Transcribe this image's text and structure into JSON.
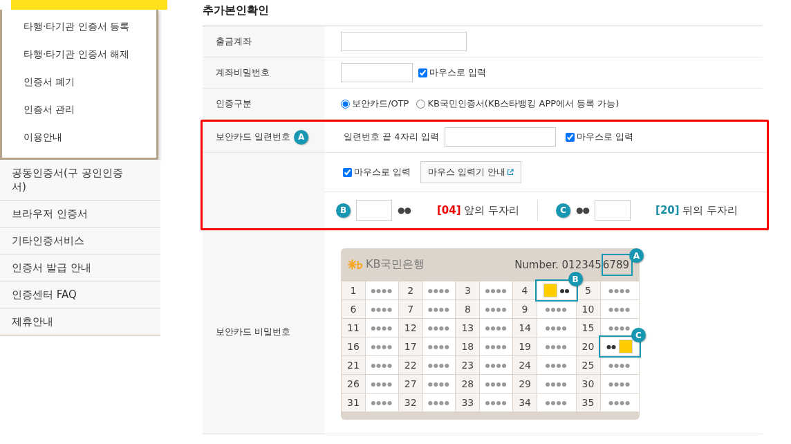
{
  "sidebar": {
    "submenu": [
      "타행·타기관 인증서 등록",
      "타행·타기관 인증서 해제",
      "인증서 폐기",
      "인증서 관리",
      "이용안내"
    ],
    "menu": [
      "공동인증서(구 공인인증서)",
      "브라우저 인증서",
      "기타인증서비스",
      "인증서 발급 안내",
      "인증센터 FAQ",
      "제휴안내"
    ]
  },
  "title": "추가본인확인",
  "rows": [
    {
      "kind": "text",
      "label": "출금계좌"
    },
    {
      "kind": "password",
      "label": "계좌비밀번호",
      "mouse_label": "마우스로 입력",
      "mouse_checked": true
    },
    {
      "kind": "radio",
      "label": "인증구분",
      "options": [
        {
          "label": "보안카드/OTP",
          "selected": true
        },
        {
          "label": "KB국민인증서(KB스타뱅킹 APP에서 등록 가능)",
          "selected": false
        }
      ]
    }
  ],
  "security": {
    "label": "보안카드 일련번호",
    "marker": "A",
    "serial_prompt": "일련번호 끝 4자리 입력",
    "serial_mouse_label": "마우스로 입력",
    "serial_mouse_checked": true,
    "mouse_label": "마우스로 입력",
    "mouse_checked": true,
    "guide_button": "마우스 입력기 안내",
    "front": {
      "marker": "B",
      "dots": "●●",
      "index": "[04]",
      "caption": "앞의 두자리"
    },
    "back": {
      "marker": "C",
      "dots": "●●",
      "index": "[20]",
      "caption": "뒤의 두자리"
    }
  },
  "card_row": {
    "label": "보안카드 비밀번호",
    "bank": "KB국민은행",
    "number": "Number. 012345",
    "number_tail": "6789",
    "number_marker": "A",
    "cells": [
      {
        "no": "1",
        "kind": "hidden",
        "dots": "●●●●"
      },
      {
        "no": "2",
        "kind": "hidden",
        "dots": "●●●●"
      },
      {
        "no": "3",
        "kind": "hidden",
        "dots": "●●●●"
      },
      {
        "no": "4",
        "kind": "front",
        "dots": "●●",
        "marker": "B"
      },
      {
        "no": "5",
        "kind": "hidden",
        "dots": "●●●●"
      },
      {
        "no": "6",
        "kind": "hidden",
        "dots": "●●●●"
      },
      {
        "no": "7",
        "kind": "hidden",
        "dots": "●●●●"
      },
      {
        "no": "8",
        "kind": "hidden",
        "dots": "●●●●"
      },
      {
        "no": "9",
        "kind": "hidden",
        "dots": "●●●●"
      },
      {
        "no": "10",
        "kind": "hidden",
        "dots": "●●●●"
      },
      {
        "no": "11",
        "kind": "hidden",
        "dots": "●●●●"
      },
      {
        "no": "12",
        "kind": "hidden",
        "dots": "●●●●"
      },
      {
        "no": "13",
        "kind": "hidden",
        "dots": "●●●●"
      },
      {
        "no": "14",
        "kind": "hidden",
        "dots": "●●●●"
      },
      {
        "no": "15",
        "kind": "hidden",
        "dots": "●●●●"
      },
      {
        "no": "16",
        "kind": "hidden",
        "dots": "●●●●"
      },
      {
        "no": "17",
        "kind": "hidden",
        "dots": "●●●●"
      },
      {
        "no": "18",
        "kind": "hidden",
        "dots": "●●●●"
      },
      {
        "no": "19",
        "kind": "hidden",
        "dots": "●●●●"
      },
      {
        "no": "20",
        "kind": "back",
        "dots": "●●",
        "marker": "C"
      },
      {
        "no": "21",
        "kind": "hidden",
        "dots": "●●●●"
      },
      {
        "no": "22",
        "kind": "hidden",
        "dots": "●●●●"
      },
      {
        "no": "23",
        "kind": "hidden",
        "dots": "●●●●"
      },
      {
        "no": "24",
        "kind": "hidden",
        "dots": "●●●●"
      },
      {
        "no": "25",
        "kind": "hidden",
        "dots": "●●●●"
      },
      {
        "no": "26",
        "kind": "hidden",
        "dots": "●●●●"
      },
      {
        "no": "27",
        "kind": "hidden",
        "dots": "●●●●"
      },
      {
        "no": "28",
        "kind": "hidden",
        "dots": "●●●●"
      },
      {
        "no": "29",
        "kind": "hidden",
        "dots": "●●●●"
      },
      {
        "no": "30",
        "kind": "hidden",
        "dots": "●●●●"
      },
      {
        "no": "31",
        "kind": "hidden",
        "dots": "●●●●"
      },
      {
        "no": "32",
        "kind": "hidden",
        "dots": "●●●●"
      },
      {
        "no": "33",
        "kind": "hidden",
        "dots": "●●●●"
      },
      {
        "no": "34",
        "kind": "hidden",
        "dots": "●●●●"
      },
      {
        "no": "35",
        "kind": "hidden",
        "dots": "●●●●"
      }
    ]
  }
}
